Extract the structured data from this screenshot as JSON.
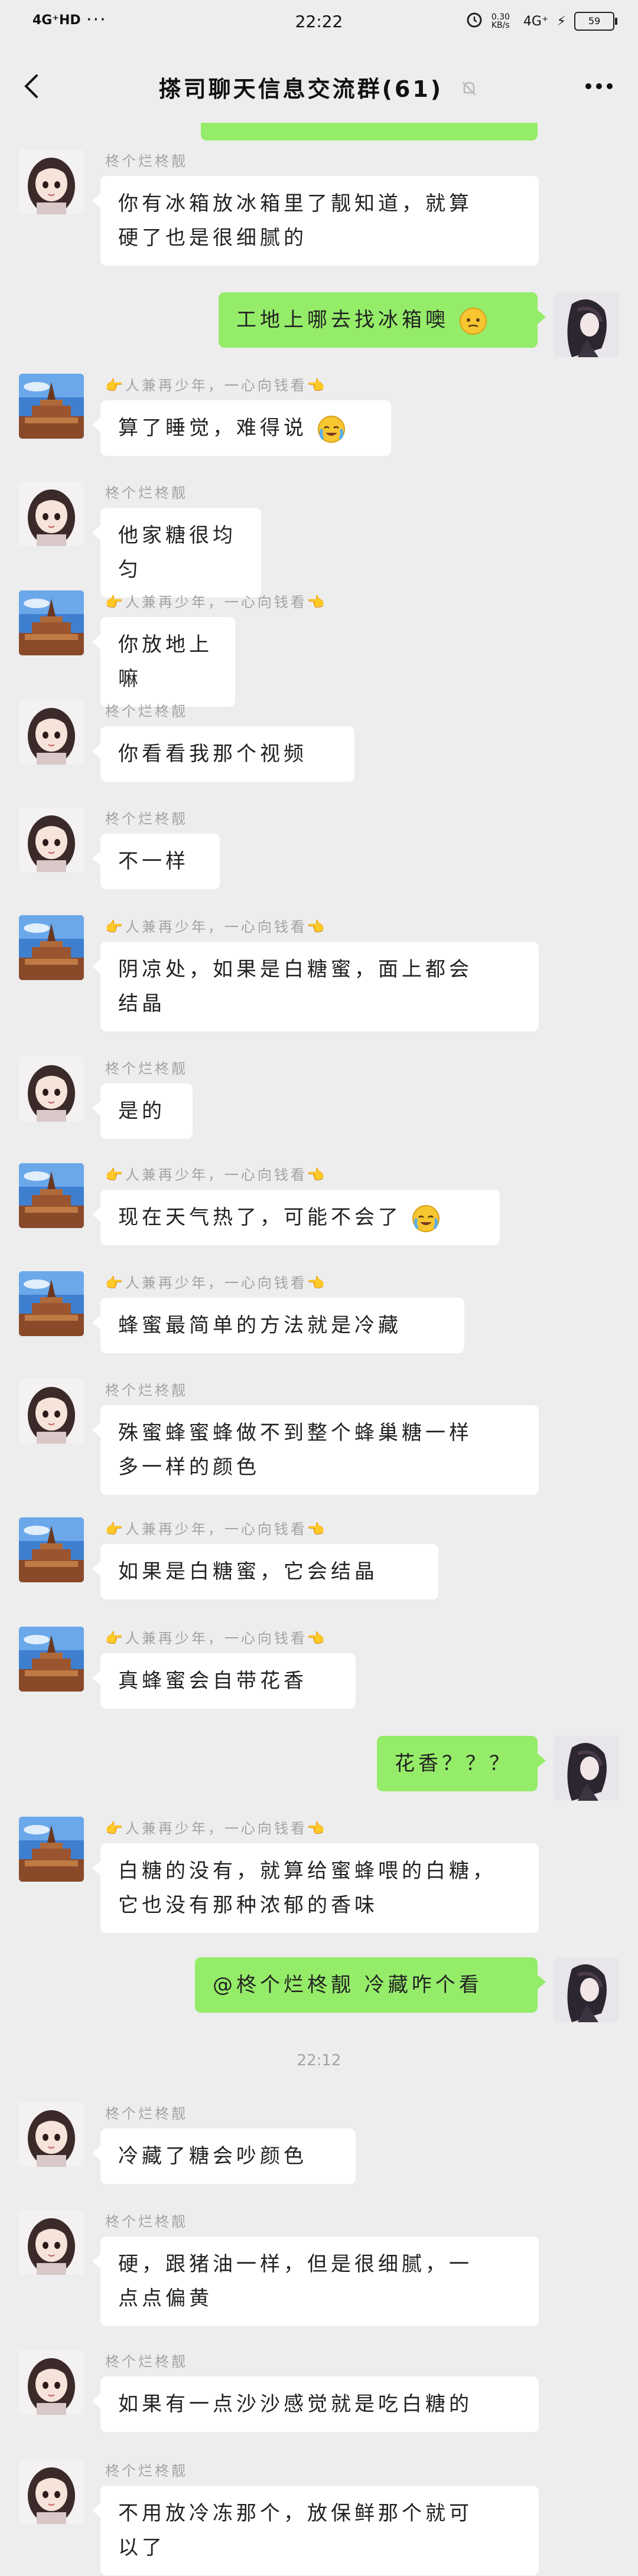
{
  "status": {
    "network": "4G⁺HD",
    "dots": "···",
    "time": "22:22",
    "speed": "0.30 KB/s",
    "signal": "4G⁺",
    "battery": "59"
  },
  "nav": {
    "title": "搽司聊天信息交流群(61)"
  },
  "colors": {
    "bg": "#ededed",
    "bubble_self": "#95ec69",
    "bubble_other": "#ffffff"
  },
  "messages": [
    {
      "sender": "柊个烂柊靓",
      "text1": "你有冰箱放冰箱里了靓知道，就算",
      "text2": "硬了也是很细腻的"
    },
    {
      "text1": "工地上哪去找冰箱噢"
    },
    {
      "sender": "👉人兼再少年，一心向钱看👈",
      "text1": "算了睡觉，难得说"
    },
    {
      "sender": "柊个烂柊靓",
      "text1": "他家糖很均匀"
    },
    {
      "sender": "👉人兼再少年，一心向钱看👈",
      "text1": "你放地上嘛"
    },
    {
      "sender": "柊个烂柊靓",
      "text1": "你看看我那个视频"
    },
    {
      "sender": "柊个烂柊靓",
      "text1": "不一样"
    },
    {
      "sender": "👉人兼再少年，一心向钱看👈",
      "text1": "阴凉处，如果是白糖蜜，面上都会",
      "text2": "结晶"
    },
    {
      "sender": "柊个烂柊靓",
      "text1": "是的"
    },
    {
      "sender": "👉人兼再少年，一心向钱看👈",
      "text1": "现在天气热了，可能不会了"
    },
    {
      "sender": "👉人兼再少年，一心向钱看👈",
      "text1": "蜂蜜最简单的方法就是冷藏"
    },
    {
      "sender": "柊个烂柊靓",
      "text1": "殊蜜蜂蜜蜂做不到整个蜂巢糖一样",
      "text2": "多一样的颜色"
    },
    {
      "sender": "👉人兼再少年，一心向钱看👈",
      "text1": "如果是白糖蜜，它会结晶"
    },
    {
      "sender": "👉人兼再少年，一心向钱看👈",
      "text1": "真蜂蜜会自带花香"
    },
    {
      "text1": "花香？？？"
    },
    {
      "sender": "👉人兼再少年，一心向钱看👈",
      "text1": "白糖的没有，就算给蜜蜂喂的白糖，",
      "text2": "它也没有那种浓郁的香味"
    },
    {
      "text1": "@柊个烂柊靓 冷藏咋个看"
    },
    {
      "sender": "柊个烂柊靓",
      "text1": "冷藏了糖会吵颜色"
    },
    {
      "sender": "柊个烂柊靓",
      "text1": "硬，跟猪油一样，但是很细腻，一",
      "text2": "点点偏黄"
    },
    {
      "sender": "柊个烂柊靓",
      "text1": "如果有一点沙沙感觉就是吃白糖的"
    },
    {
      "sender": "柊个烂柊靓",
      "text1": "不用放冷冻那个，放保鲜那个就可",
      "text2": "以了"
    }
  ],
  "timestamp": "22:12"
}
